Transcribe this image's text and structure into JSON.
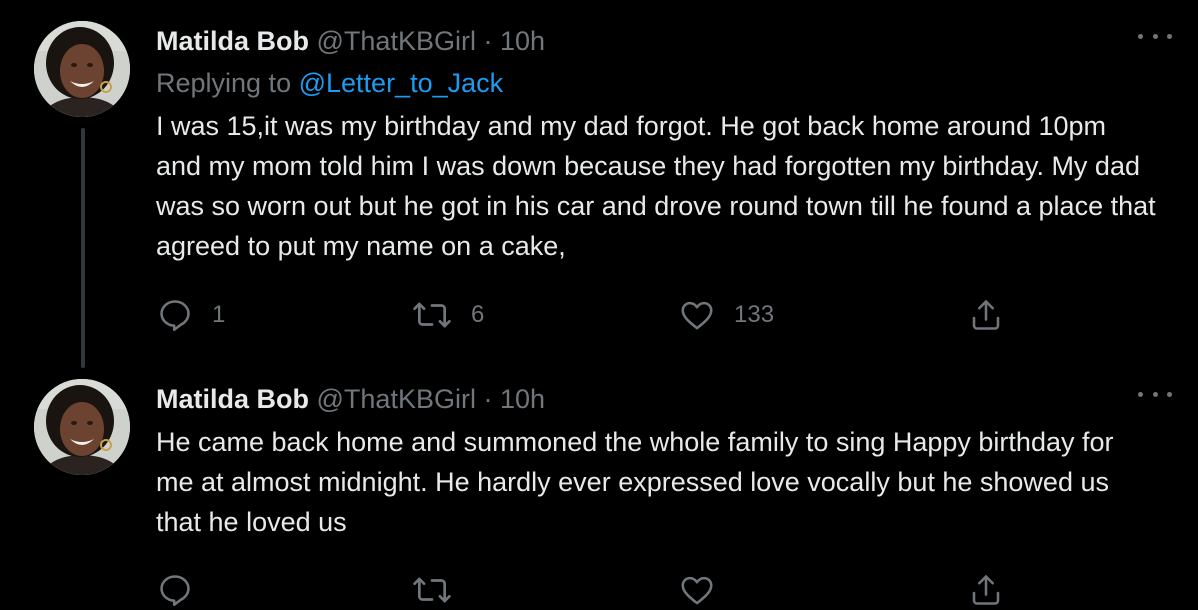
{
  "tweets": [
    {
      "name": "Matilda Bob",
      "handle": "@ThatKBGirl",
      "separator": "·",
      "time": "10h",
      "replying_prefix": "Replying to",
      "replying_to": "@Letter_to_Jack",
      "text": "I was 15,it was my birthday and my dad forgot. He got back home around 10pm and my mom told him I was down because they had forgotten my birthday. My dad was so worn out but he got in his car and drove round town till he found a place that agreed to put my name on a cake,",
      "replies": "1",
      "retweets": "6",
      "likes": "133"
    },
    {
      "name": "Matilda Bob",
      "handle": "@ThatKBGirl",
      "separator": "·",
      "time": "10h",
      "text": "He came back home and summoned the whole family to sing Happy birthday for me at almost midnight. He hardly ever expressed love vocally but he showed us that he loved us"
    }
  ],
  "icons": {
    "reply": "reply-icon",
    "retweet": "retweet-icon",
    "like": "heart-icon",
    "share": "share-icon",
    "more": "more-icon"
  },
  "colors": {
    "background": "#000000",
    "text": "#e7e9ea",
    "muted": "#71767b",
    "link": "#1d9bf0",
    "thread_line": "#333639"
  }
}
